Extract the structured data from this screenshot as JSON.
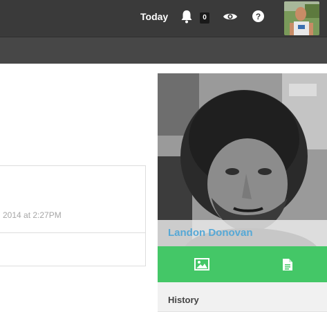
{
  "topbar": {
    "today_label": "Today",
    "notifications_count": "0",
    "icons": [
      "bell-icon",
      "eye-icon",
      "help-icon"
    ]
  },
  "content": {
    "timestamp": "2014 at 2:27PM"
  },
  "profile": {
    "name": "Landon Donovan",
    "actions": [
      "image-icon",
      "document-icon"
    ],
    "section_title": "History"
  },
  "colors": {
    "topbar": "#3a3a3a",
    "subbar": "#474747",
    "accent_green": "#44c767",
    "name_blue": "#56a8d6"
  }
}
